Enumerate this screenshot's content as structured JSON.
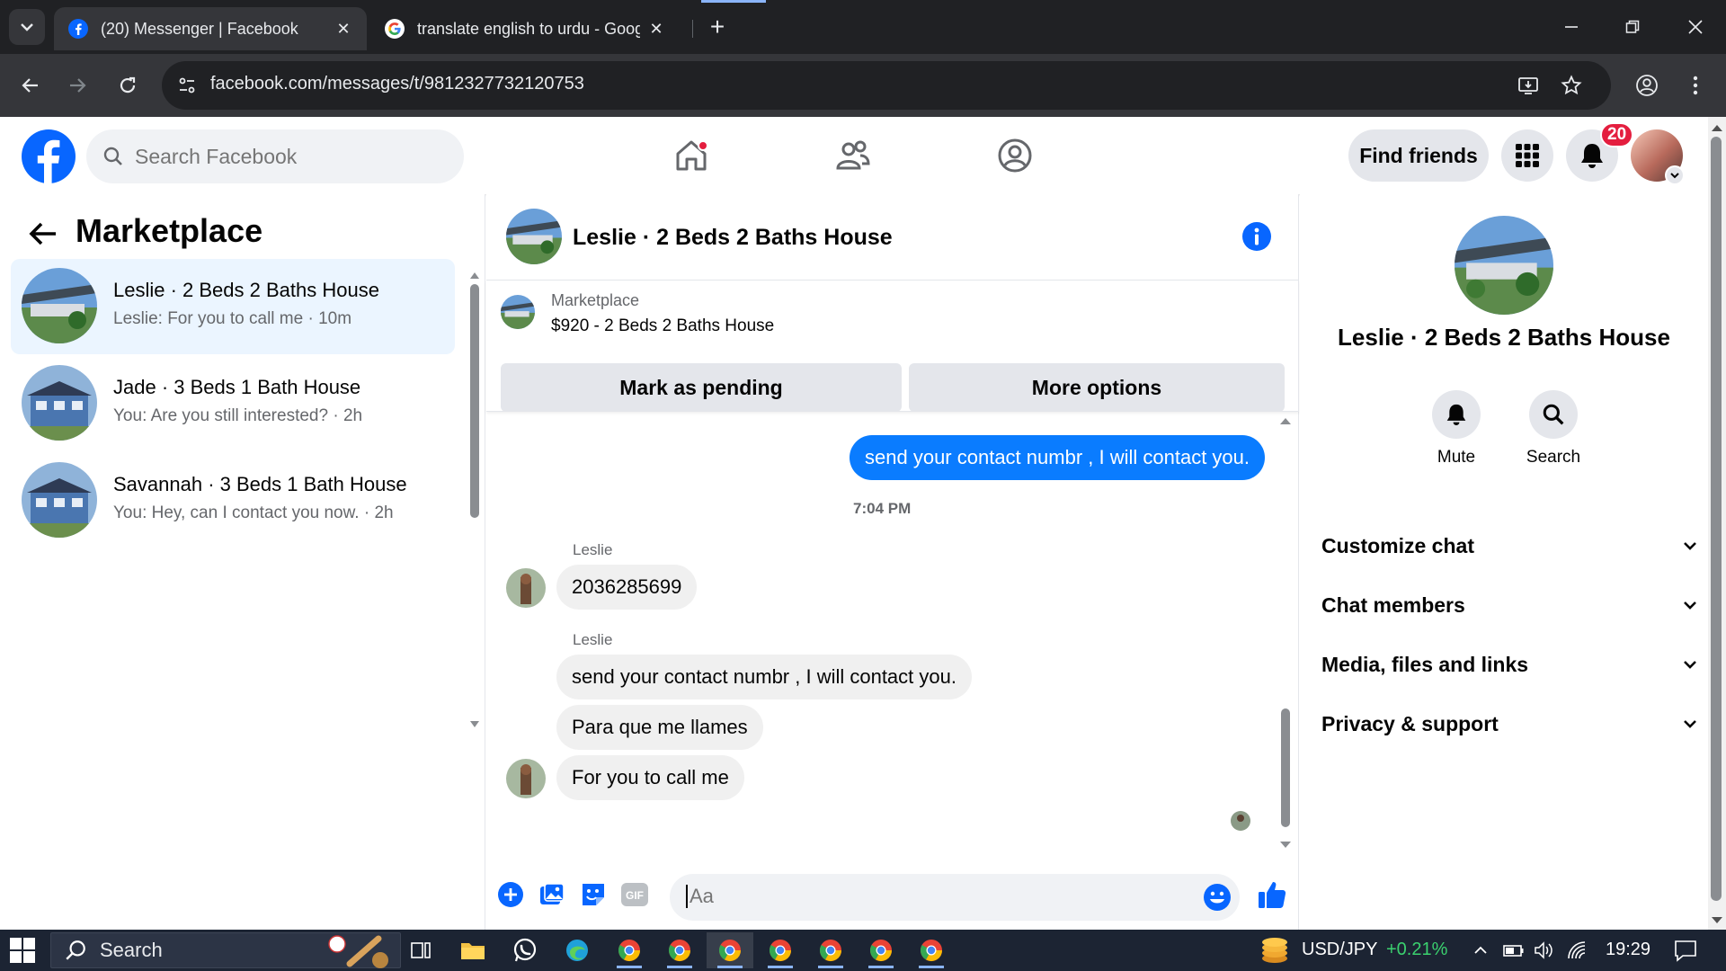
{
  "browser": {
    "tabs": [
      {
        "title": "(20) Messenger | Facebook",
        "active": true
      },
      {
        "title": "translate english to urdu - Goog",
        "active": false
      }
    ],
    "url": "facebook.com/messages/t/9812327732120753"
  },
  "header": {
    "search_placeholder": "Search Facebook",
    "find_friends_label": "Find friends",
    "notification_count": "20"
  },
  "left": {
    "title": "Marketplace",
    "conversations": [
      {
        "name": "Leslie · 2 Beds 2 Baths House",
        "preview": "Leslie: For you to call me · 10m",
        "selected": true
      },
      {
        "name": "Jade · 3 Beds 1 Bath House",
        "preview": "You: Are you still interested? · 2h",
        "selected": false
      },
      {
        "name": "Savannah · 3 Beds 1 Bath House",
        "preview": "You: Hey, can I contact you now. · 2h",
        "selected": false
      }
    ]
  },
  "chat": {
    "title": "Leslie · 2 Beds 2 Baths House",
    "marketplace_label": "Marketplace",
    "listing": "$920 - 2 Beds 2 Baths House",
    "mark_pending_label": "Mark as pending",
    "more_options_label": "More options",
    "messages": [
      {
        "dir": "out",
        "text": "send your contact numbr , I will contact you."
      },
      {
        "type": "timestamp",
        "text": "7:04 PM"
      },
      {
        "dir": "in",
        "sender": "Leslie",
        "text": "2036285699"
      },
      {
        "dir": "in",
        "sender": "Leslie",
        "text": "send your contact numbr , I will contact you."
      },
      {
        "dir": "in",
        "text": "Para que me llames"
      },
      {
        "dir": "in",
        "text": "For you to call me"
      }
    ],
    "composer_placeholder": "Aa"
  },
  "right": {
    "name": "Leslie · 2 Beds 2 Baths House",
    "actions": [
      {
        "label": "Mute",
        "icon": "bell-icon"
      },
      {
        "label": "Search",
        "icon": "search-icon"
      }
    ],
    "sections": [
      {
        "label": "Customize chat"
      },
      {
        "label": "Chat members"
      },
      {
        "label": "Media, files and links"
      },
      {
        "label": "Privacy & support"
      }
    ]
  },
  "taskbar": {
    "search_label": "Search",
    "ticker": "USD/JPY",
    "ticker_change": "+0.21%",
    "time": "19:29"
  },
  "colors": {
    "fb_blue": "#0866ff",
    "bubble_out": "#0a7cff",
    "selected_bg": "#ebf5ff",
    "badge_red": "#e41e3f",
    "ticker_green": "#3bd16f"
  }
}
